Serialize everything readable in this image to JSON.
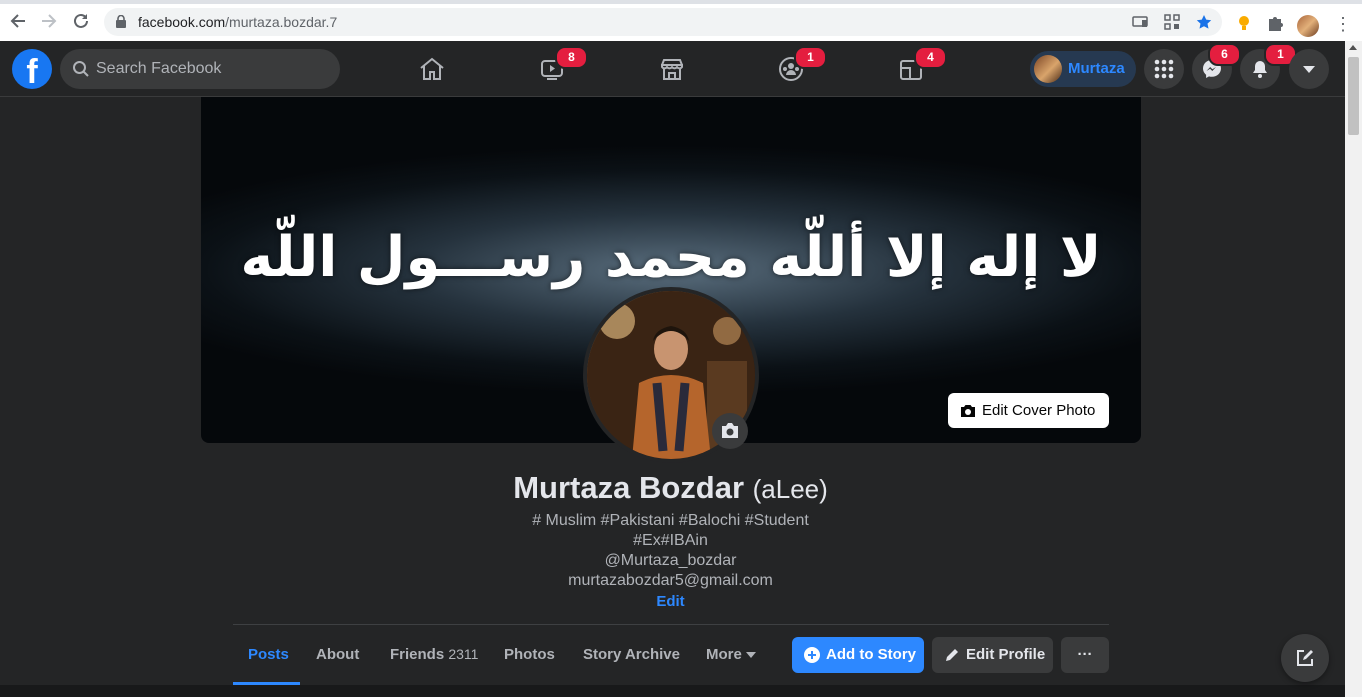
{
  "browser": {
    "url_host": "facebook.com",
    "url_path": "/murtaza.bozdar.7"
  },
  "header": {
    "search_placeholder": "Search Facebook",
    "nav_badges": {
      "watch": "8",
      "groups": "1",
      "gaming": "4"
    },
    "profile_chip_name": "Murtaza",
    "messenger_badge": "6",
    "notifications_badge": "1"
  },
  "cover": {
    "text": "لا إله إلا أللّه محمد رســـول اللّه",
    "edit_label": "Edit Cover Photo"
  },
  "profile": {
    "name": "Murtaza Bozdar",
    "alt_name": "(aLee)",
    "bio_lines": [
      "# Muslim #Pakistani #Balochi #Student",
      "#Ex#IBAin",
      "@Murtaza_bozdar",
      "murtazabozdar5@gmail.com"
    ],
    "bio_edit": "Edit"
  },
  "tabs": {
    "posts": "Posts",
    "about": "About",
    "friends": "Friends",
    "friends_count": "2311",
    "photos": "Photos",
    "story_archive": "Story Archive",
    "more": "More"
  },
  "actions": {
    "add_story": "Add to Story",
    "edit_profile": "Edit Profile",
    "more": "···"
  },
  "colors": {
    "brand": "#1877f2",
    "accent": "#2d88ff",
    "badge": "#e41e3f",
    "surface": "#242526"
  }
}
